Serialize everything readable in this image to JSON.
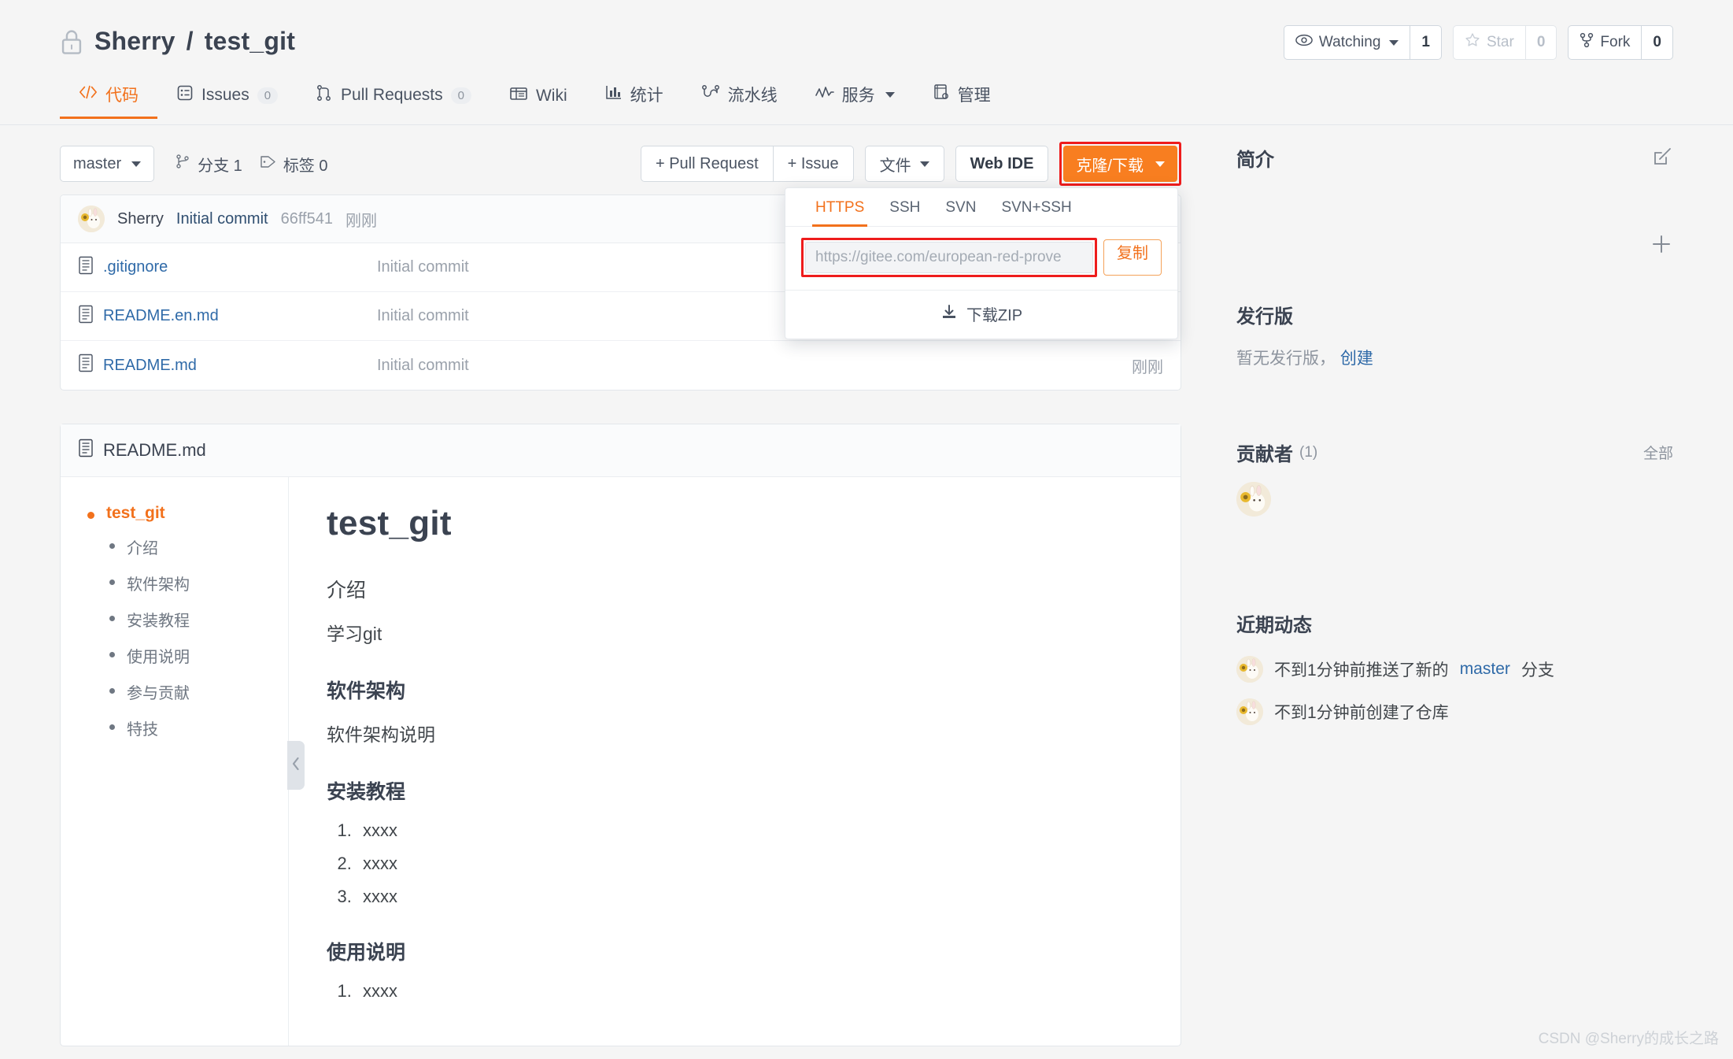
{
  "header": {
    "owner": "Sherry",
    "separator": "/",
    "repo": "test_git",
    "lock_icon": "lock-icon",
    "watching_label": "Watching",
    "watching_count": "1",
    "star_label": "Star",
    "star_count": "0",
    "fork_label": "Fork",
    "fork_count": "0"
  },
  "nav": {
    "tabs": [
      {
        "label": "代码",
        "icon": "code-icon",
        "badge": null,
        "active": true
      },
      {
        "label": "Issues",
        "icon": "issue-icon",
        "badge": "0",
        "active": false
      },
      {
        "label": "Pull Requests",
        "icon": "pull-request-icon",
        "badge": "0",
        "active": false
      },
      {
        "label": "Wiki",
        "icon": "wiki-icon",
        "badge": null,
        "active": false
      },
      {
        "label": "统计",
        "icon": "stats-icon",
        "badge": null,
        "active": false
      },
      {
        "label": "流水线",
        "icon": "pipeline-icon",
        "badge": null,
        "active": false
      },
      {
        "label": "服务",
        "icon": "service-icon",
        "badge": null,
        "active": false,
        "dropdown": true
      },
      {
        "label": "管理",
        "icon": "manage-icon",
        "badge": null,
        "active": false
      }
    ]
  },
  "toolbar": {
    "branch": "master",
    "branches_label": "分支 1",
    "tags_label": "标签 0",
    "pull_request_label": "+ Pull Request",
    "issue_label": "+ Issue",
    "files_label": "文件",
    "web_ide_label": "Web IDE",
    "clone_label": "克隆/下载"
  },
  "clone_panel": {
    "tabs": [
      "HTTPS",
      "SSH",
      "SVN",
      "SVN+SSH"
    ],
    "active_tab": "HTTPS",
    "url_value": "https://gitee.com/european-red-prove",
    "url_placeholder": "https://gitee.com/european-red-prove",
    "copy_label": "复制",
    "download_zip_label": "下载ZIP"
  },
  "commit_bar": {
    "author": "Sherry",
    "message": "Initial commit",
    "sha": "66ff541",
    "time": "刚刚"
  },
  "files": [
    {
      "name": ".gitignore",
      "message": "Initial commit",
      "time": ""
    },
    {
      "name": "README.en.md",
      "message": "Initial commit",
      "time": ""
    },
    {
      "name": "README.md",
      "message": "Initial commit",
      "time": "刚刚"
    }
  ],
  "readme": {
    "filename": "README.md",
    "toc_root": "test_git",
    "toc_items": [
      "介绍",
      "软件架构",
      "安装教程",
      "使用说明",
      "参与贡献",
      "特技"
    ],
    "title": "test_git",
    "sections": [
      {
        "heading": "介绍",
        "heading_style": "plain",
        "paragraph": "学习git"
      },
      {
        "heading": "软件架构",
        "heading_style": "bold",
        "paragraph": "软件架构说明"
      },
      {
        "heading": "安装教程",
        "heading_style": "bold",
        "list": [
          "xxxx",
          "xxxx",
          "xxxx"
        ]
      },
      {
        "heading": "使用说明",
        "heading_style": "bold",
        "list": [
          "xxxx"
        ]
      }
    ]
  },
  "sidebar": {
    "intro_title": "简介",
    "edit_icon": "edit-icon",
    "add_icon": "plus-icon",
    "release_title": "发行版",
    "release_empty": "暂无发行版，",
    "release_create": "创建",
    "contributors_title": "贡献者",
    "contributors_count": "(1)",
    "contributors_all": "全部",
    "activity_title": "近期动态",
    "activities": [
      {
        "prefix": "不到1分钟前推送了新的 ",
        "highlight": "master",
        "suffix": " 分支"
      },
      {
        "prefix": "不到1分钟前创建了仓库",
        "highlight": "",
        "suffix": ""
      }
    ]
  },
  "watermark": "CSDN @Sherry的成长之路",
  "colors": {
    "accent_orange": "#f87e20",
    "tab_orange": "#f2711c",
    "link_blue": "#2f6aa8",
    "highlight_red": "#ee1c1c"
  }
}
